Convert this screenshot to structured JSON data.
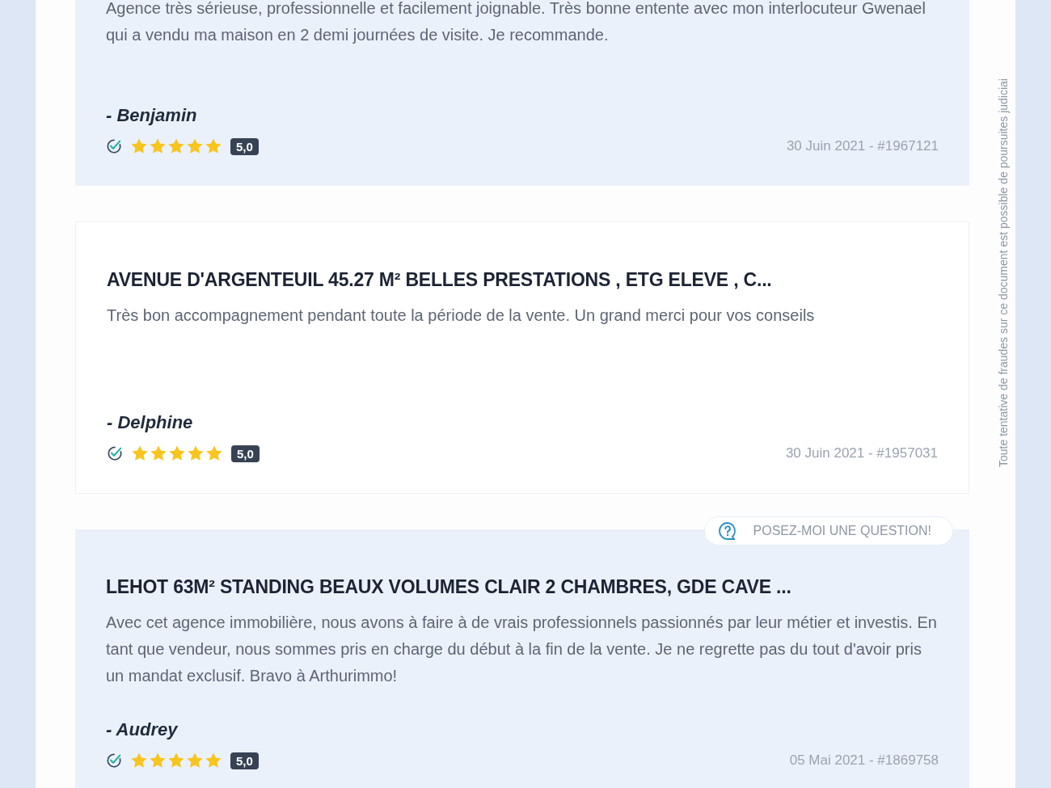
{
  "side_notice": "Toute tentative de fraudes sur ce document est possible de poursuites judiciai",
  "reviews": [
    {
      "shaded": true,
      "text": "Agence très sérieuse, professionnelle et facilement joignable. Très bonne entente avec mon interlocuteur Gwenael qui a vendu ma maison en 2 demi journées de visite. Je recommande.",
      "author": "- Benjamin",
      "verified": true,
      "stars": 5,
      "score": "5,0",
      "date": "30 Juin 2021 - #1967121"
    },
    {
      "shaded": false,
      "title": "AVENUE D'ARGENTEUIL 45.27 M² BELLES PRESTATIONS , ETG ELEVE , C...",
      "text": "Très bon accompagnement pendant toute la période de la vente. Un grand merci pour vos conseils",
      "author": "- Delphine",
      "verified": true,
      "stars": 5,
      "score": "5,0",
      "date": "30 Juin 2021 - #1957031"
    },
    {
      "shaded": true,
      "title": "LEHOT 63M² STANDING BEAUX VOLUMES CLAIR 2 CHAMBRES, GDE CAVE ...",
      "text": "Avec cet agence immobilière, nous avons à faire à de vrais professionnels passionnés par leur métier et investis. En tant que vendeur, nous sommes pris en charge du début à la fin de la vente. Je ne regrette pas du tout d'avoir pris un mandat exclusif. Bravo à Arthurimmo!",
      "author": "- Audrey",
      "verified": true,
      "stars": 5,
      "score": "5,0",
      "date": "05 Mai 2021 - #1869758",
      "question_button": "POSEZ-MOI UNE QUESTION!"
    }
  ]
}
